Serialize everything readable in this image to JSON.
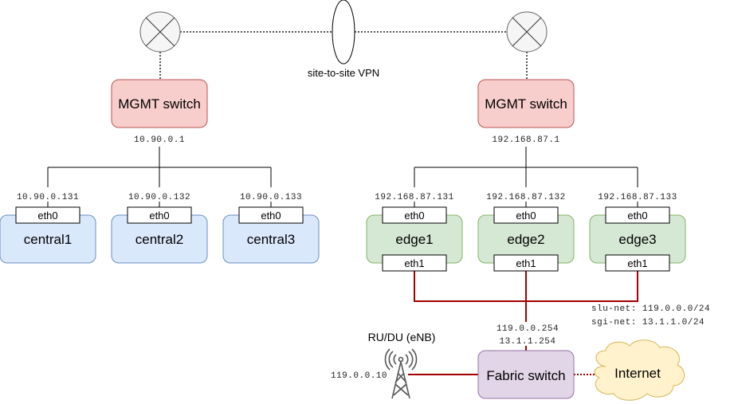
{
  "vpn_label": "site-to-site VPN",
  "central_site": {
    "switch_label": "MGMT switch",
    "switch_ip": "10.90.0.1",
    "nodes": [
      {
        "name": "central1",
        "ip": "10.90.0.131",
        "iface": "eth0"
      },
      {
        "name": "central2",
        "ip": "10.90.0.132",
        "iface": "eth0"
      },
      {
        "name": "central3",
        "ip": "10.90.0.133",
        "iface": "eth0"
      }
    ]
  },
  "edge_site": {
    "switch_label": "MGMT switch",
    "switch_ip": "192.168.87.1",
    "nodes": [
      {
        "name": "edge1",
        "ip": "192.168.87.131",
        "iface": "eth0",
        "iface2": "eth1"
      },
      {
        "name": "edge2",
        "ip": "192.168.87.132",
        "iface": "eth0",
        "iface2": "eth1"
      },
      {
        "name": "edge3",
        "ip": "192.168.87.133",
        "iface": "eth0",
        "iface2": "eth1"
      }
    ],
    "nets": [
      "slu-net: 119.0.0.0/24",
      "sgi-net: 13.1.1.0/24"
    ],
    "fabric_ips": [
      "119.0.0.254",
      "13.1.1.254"
    ],
    "fabric_label": "Fabric switch",
    "enb_label": "RU/DU (eNB)",
    "enb_ip": "119.0.0.10",
    "internet_label": "Internet"
  },
  "colors": {
    "mgmt_fill": "#f8cecc",
    "mgmt_stroke": "#b85450",
    "central_fill": "#dae8fc",
    "central_stroke": "#6c8ebf",
    "edge_fill": "#d5e8d4",
    "edge_stroke": "#82b366",
    "fabric_fill": "#e1d5e7",
    "fabric_stroke": "#9673a6",
    "cloud_fill": "#fff2cc",
    "cloud_stroke": "#d6b656",
    "data_link": "#a20000"
  }
}
